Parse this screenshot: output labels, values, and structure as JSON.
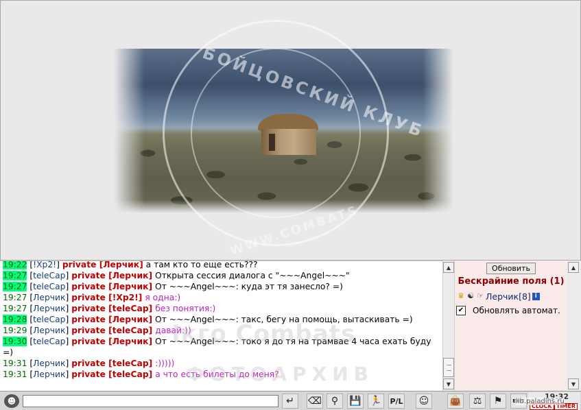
{
  "watermark": {
    "arc_top": "БОЙЦОВСКИЙ КЛУБ",
    "arc_bottom": "WWW.COMBATS",
    "chat_line1": "Iкго Combats",
    "chat_line2": "ФОТОАРХИВ"
  },
  "chat": {
    "lines": [
      {
        "time": "19:22",
        "hl": true,
        "nick": "!Xp2!",
        "to": "Лерчик",
        "msg": "а там кто то еще есть???",
        "color": "black"
      },
      {
        "time": "19:27",
        "hl": true,
        "nick": "teleCap",
        "to": "Лерчик",
        "msg": "Открыта сессия диалога с \"~~~Angel~~~\"",
        "color": "black"
      },
      {
        "time": "19:27",
        "hl": true,
        "nick": "teleCap",
        "to": "Лерчик",
        "msg": "От ~~~Angel~~~: куда эт тя занесло? =)",
        "color": "black"
      },
      {
        "time": "19:27",
        "hl": false,
        "nick": "Лерчик",
        "to": "!Xp2!",
        "msg": "я одна:)",
        "color": "purple"
      },
      {
        "time": "19:27",
        "hl": false,
        "nick": "Лерчик",
        "to": "teleCap",
        "msg": "без понятия:)",
        "color": "purple"
      },
      {
        "time": "19:28",
        "hl": true,
        "nick": "teleCap",
        "to": "Лерчик",
        "msg": "От ~~~Angel~~~: такс, бегу на помощь, вытаскивать =)",
        "color": "black"
      },
      {
        "time": "19:29",
        "hl": false,
        "nick": "Лерчик",
        "to": "teleCap",
        "msg": "давай:))",
        "color": "purple"
      },
      {
        "time": "19:30",
        "hl": true,
        "nick": "teleCap",
        "to": "Лерчик",
        "msg": "От ~~~Angel~~~: токо я до тя на трамвае 4 часа ехать буду =)",
        "color": "black"
      },
      {
        "time": "19:31",
        "hl": false,
        "nick": "Лерчик",
        "to": "teleCap",
        "msg": ":)))))",
        "color": "purple"
      },
      {
        "time": "19:31",
        "hl": false,
        "nick": "Лерчик",
        "to": "teleCap",
        "msg": "а что есть билеты до меня?",
        "color": "purple"
      }
    ],
    "private_word": "private"
  },
  "panel": {
    "refresh_label": "Обновить",
    "location": "Бескрайние поля (1)",
    "user": "Лерчик[8]",
    "info_icon": "i",
    "auto_label": "Обновлять автомат.",
    "auto_checked": true
  },
  "toolbar": {
    "input_value": "",
    "clock_time": "19:32",
    "clock_label": "CLOCK",
    "timer_label": "TIMER",
    "exit_label": "EXIT",
    "site_watermark": "lib.paladins.ru"
  },
  "icons": {
    "send": "send-icon",
    "clear": "eraser-icon",
    "filter": "filter-icon",
    "save": "save-icon",
    "fight": "fight-icon",
    "pl": "pl-icon",
    "smile": "smile-icon",
    "bag": "bag-icon",
    "trade": "trade-icon",
    "flag": "flag-icon",
    "exit": "exit-icon"
  },
  "colors": {
    "timestamp_highlight": "#00ff7f",
    "private": "#c20000",
    "own_message": "#c020c0",
    "location": "#8b0000",
    "panel_bg": "#fbeaea"
  }
}
